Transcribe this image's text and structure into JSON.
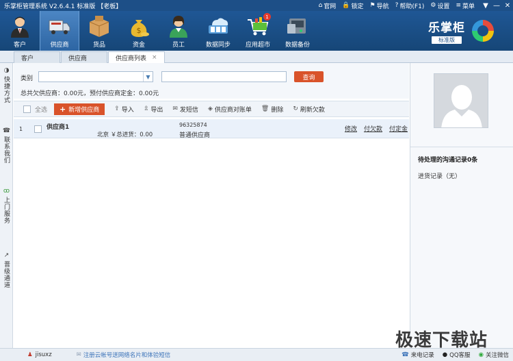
{
  "titlebar": {
    "title": "乐掌柜管理系统 V2.6.4.1 标准版 【老板】",
    "links": [
      {
        "icon": "home-icon",
        "glyph": "⌂",
        "label": "官网"
      },
      {
        "icon": "lock-icon",
        "glyph": "🔒",
        "label": "锁定"
      },
      {
        "icon": "nav-icon",
        "glyph": "⚑",
        "label": "导航"
      },
      {
        "icon": "help-icon",
        "glyph": "?",
        "label": "帮助(F1)"
      },
      {
        "icon": "gear-icon",
        "glyph": "⚙",
        "label": "设置"
      },
      {
        "icon": "menu-icon",
        "glyph": "≡",
        "label": "菜单"
      }
    ],
    "window_buttons": [
      "▼",
      "—",
      "✕"
    ]
  },
  "toolbar": {
    "items": [
      {
        "label": "客户"
      },
      {
        "label": "供应商"
      },
      {
        "label": "货品"
      },
      {
        "label": "资金"
      },
      {
        "label": "员工"
      },
      {
        "label": "数据同步"
      },
      {
        "label": "应用超市",
        "badge": "1"
      },
      {
        "label": "数据备份"
      }
    ],
    "brand_name": "乐掌柜",
    "brand_edition": "标准版"
  },
  "tabs": [
    {
      "label": "客户"
    },
    {
      "label": "供应商"
    },
    {
      "label": "供应商列表",
      "close": "×"
    }
  ],
  "sidebar": {
    "items": [
      {
        "icon": "quick-icon",
        "glyph": "◑",
        "label": "快捷方式"
      },
      {
        "icon": "phone-icon",
        "glyph": "☎",
        "label": "联系我们"
      },
      {
        "icon": "bike-icon",
        "glyph": "ꝏ",
        "label": "上门服务"
      },
      {
        "icon": "trend-icon",
        "glyph": "↗",
        "label": "晋级通道"
      }
    ]
  },
  "filter": {
    "category_label": "类别",
    "query_button": "查询",
    "summary": "总共欠供应商：0.00元，预付供应商定金：0.00元"
  },
  "actions": {
    "select_all": "全选",
    "add": "新增供应商",
    "items": [
      {
        "icon": "import-icon",
        "glyph": "⇪",
        "label": "导入"
      },
      {
        "icon": "export-icon",
        "glyph": "⇫",
        "label": "导出"
      },
      {
        "icon": "sms-icon",
        "glyph": "✉",
        "label": "发短信"
      },
      {
        "icon": "tag-icon",
        "glyph": "◈",
        "label": "供应商对账单"
      },
      {
        "icon": "trash-icon",
        "glyph": "🗑",
        "label": "删除"
      },
      {
        "icon": "refresh-icon",
        "glyph": "↻",
        "label": "刷新欠款"
      }
    ]
  },
  "rows": [
    {
      "index": "1",
      "name": "供应商1",
      "sub": "北京 ￥总进货：0.00",
      "phone": "96325874",
      "type": "普通供应商",
      "links": [
        "修改",
        "付欠款",
        "付定金"
      ]
    }
  ],
  "right_panel": {
    "pending": "待处理的沟通记录0条",
    "record": "进货记录（无）"
  },
  "statusbar": {
    "user": "jisuxz",
    "register": "注册云帐号送网络名片和体验短信",
    "right": [
      {
        "icon": "call-icon",
        "glyph": "☎",
        "label": "来电记录"
      },
      {
        "icon": "qq-icon",
        "glyph": "●",
        "label": "QQ客服"
      },
      {
        "icon": "wechat-icon",
        "glyph": "◉",
        "label": "关注微信"
      }
    ]
  },
  "watermark": "极速下载站",
  "colors": {
    "primary": "#1d4f87",
    "accent": "#d9532a",
    "row_highlight": "#eaf1fa"
  }
}
